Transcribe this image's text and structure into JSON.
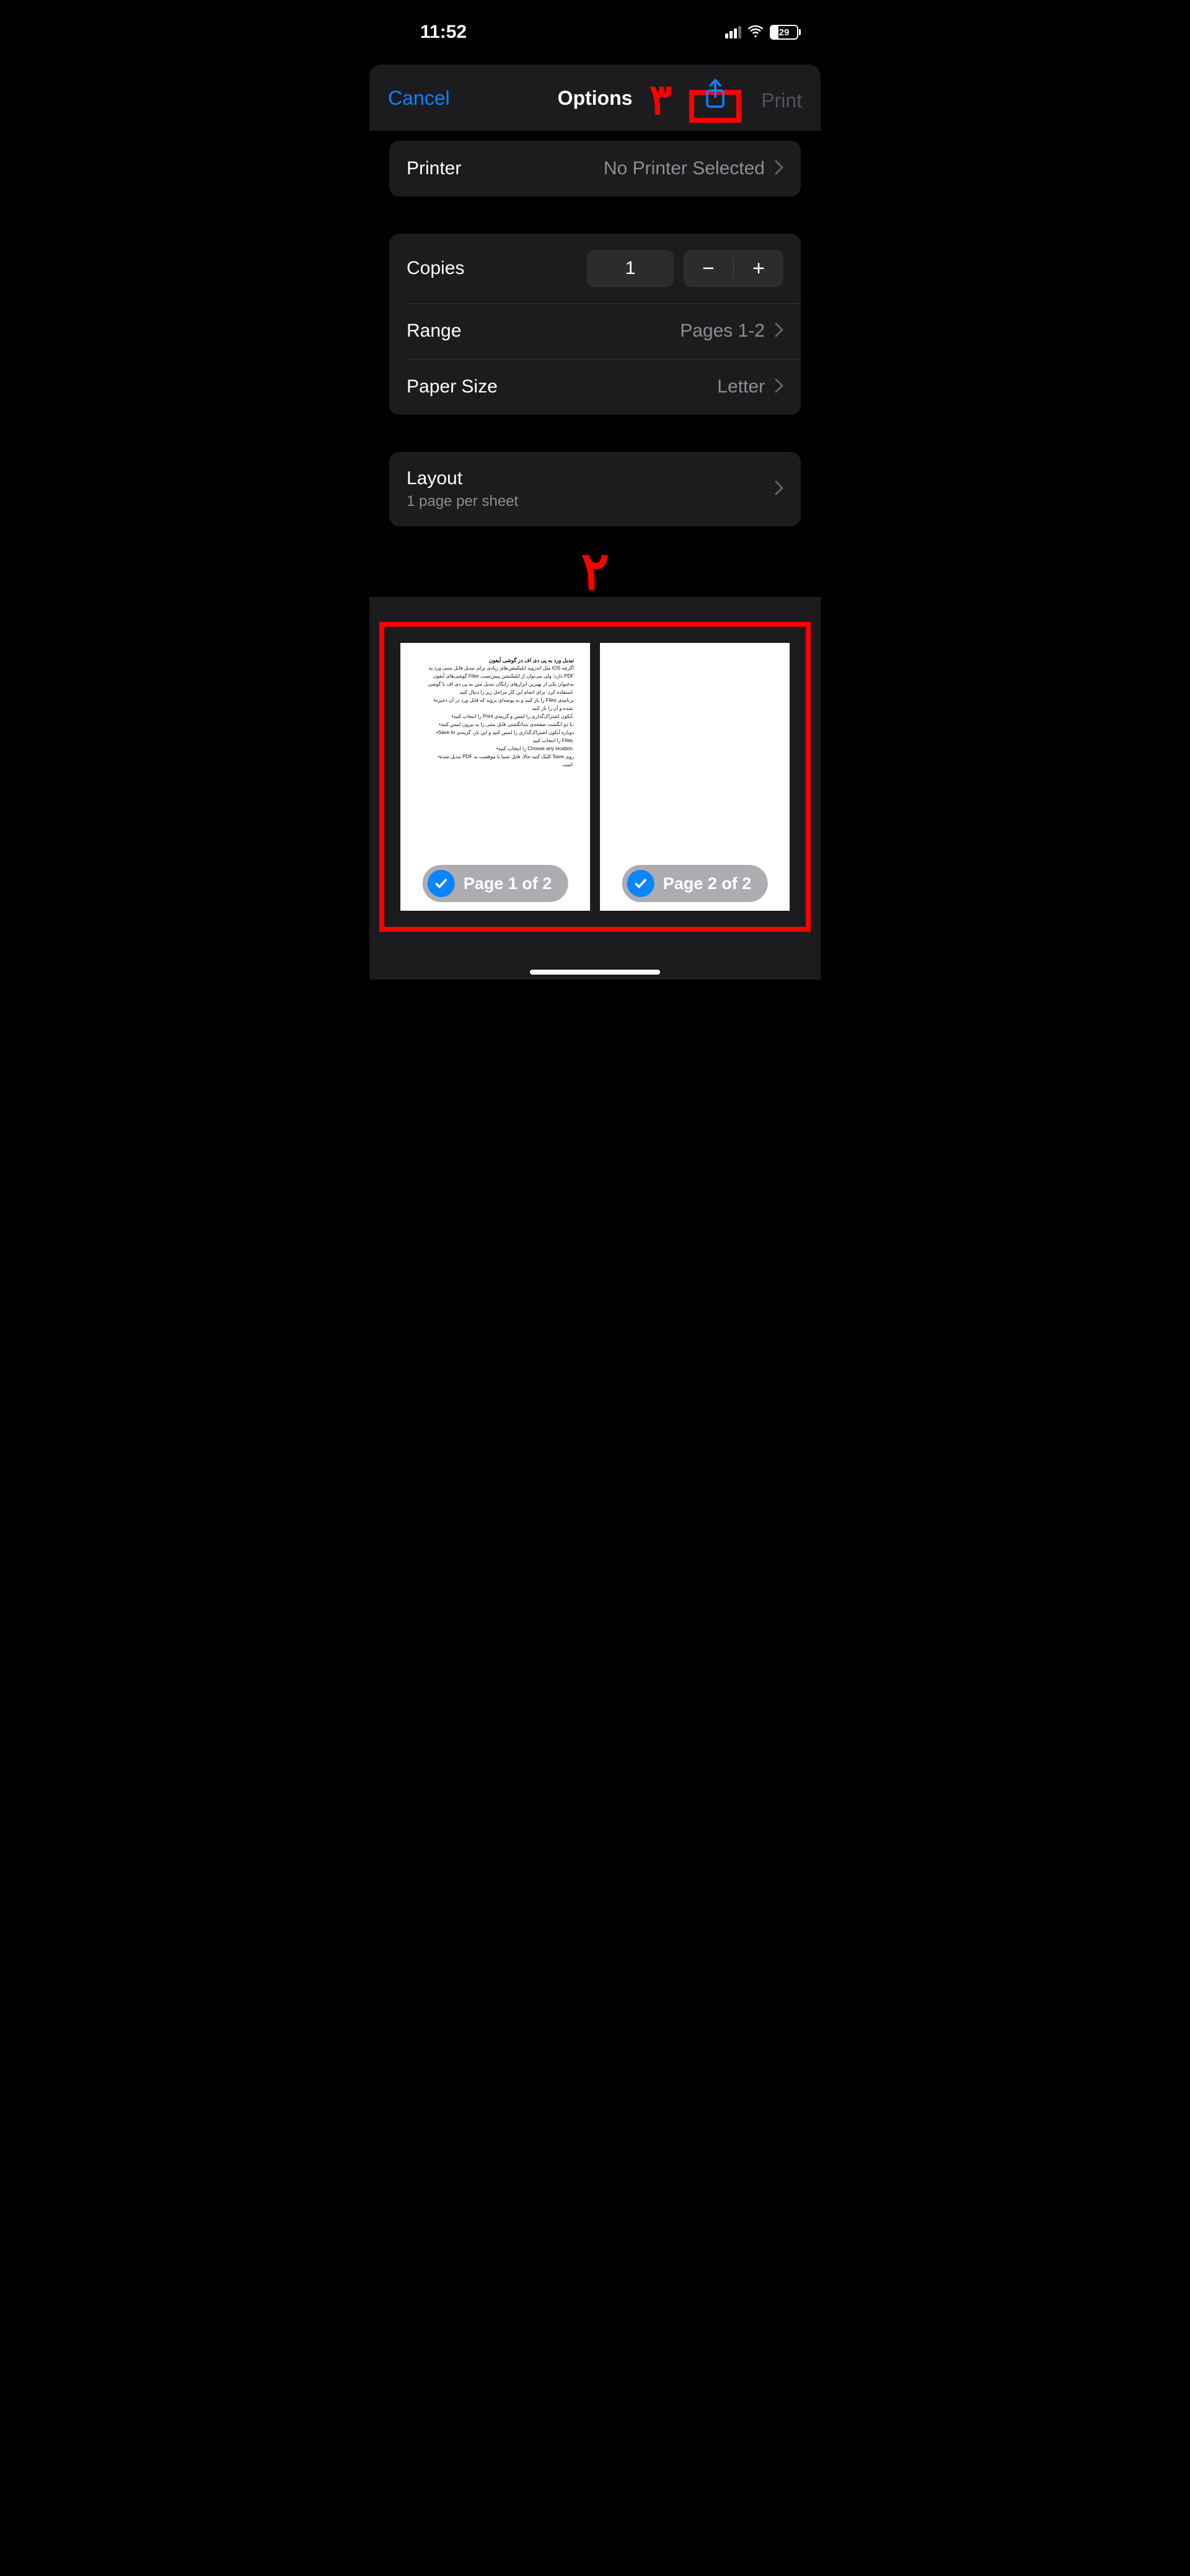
{
  "status": {
    "time": "11:52",
    "battery_percent": "29"
  },
  "nav": {
    "cancel": "Cancel",
    "title": "Options",
    "print": "Print"
  },
  "annotations": {
    "step2": "۲",
    "step3": "۳"
  },
  "printer": {
    "label": "Printer",
    "value": "No Printer Selected"
  },
  "copies": {
    "label": "Copies",
    "value": "1"
  },
  "range": {
    "label": "Range",
    "value": "Pages 1-2"
  },
  "paperSize": {
    "label": "Paper Size",
    "value": "Letter"
  },
  "layout": {
    "label": "Layout",
    "sub": "1 page per sheet"
  },
  "pages": {
    "badge1": "Page 1 of 2",
    "badge2": "Page 2 of 2"
  },
  "doc": {
    "title": "تبدیل ورد به پی دی اف در گوشی آیفون",
    "lines": [
      "اگرچه iOS مثل اندروید اپلیکیشن‌های زیادی برای تبدیل فایل متنی ورد به",
      "PDF دارد؛ ولی می‌توان از اپلیکیشن پیش‌نصب Files گوشی‌های آیفون",
      "به‌عنوان یکی از بهترین ابزارهای رایگان تبدیل متن به پی دی اف با گوشی",
      ".استفاده کرد. برای انجام این کار مراحل زیر را دنبال کنید",
      "برنامه‌ی Files را باز کنید و به پوشه‌ای بروید که فایل ورد در آن ذخیره•",
      ".شده و آن را باز کنید",
      ".آیکون اشتراک‌گذاری را لمس و گزینه‌ی Print را انتخاب کنید•",
      ".با دو انگشت صفحه‌ی بندانگشتی فایل متنی را به بیرون لمس کنید•",
      "دوباره آیکون اشتراک‌گذاری را لمس کنید و این بار، گزینه‌ی Save to•",
      ".Files را انتخاب کنید",
      ".Choose any location را انتخاب کنید•",
      "روی Save کلیک کنید.حالا، فایل شما با موفقیت به PDF تبدیل شده•",
      ".است"
    ]
  }
}
